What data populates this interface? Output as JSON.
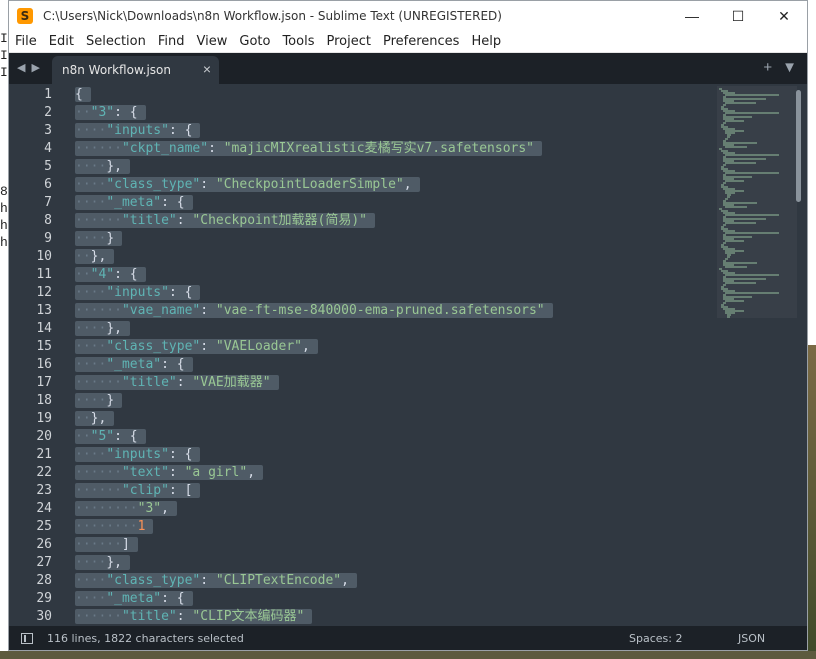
{
  "desktop_left_chars": [
    "I",
    "I",
    "I",
    "",
    "",
    "",
    "",
    "",
    "",
    "8",
    "h",
    "h",
    "h"
  ],
  "window": {
    "title": "C:\\Users\\Nick\\Downloads\\n8n Workflow.json - Sublime Text (UNREGISTERED)",
    "app_icon_letter": "S",
    "controls": {
      "minimize": "—",
      "maximize": "☐",
      "close": "✕"
    }
  },
  "menu": [
    "File",
    "Edit",
    "Selection",
    "Find",
    "View",
    "Goto",
    "Tools",
    "Project",
    "Preferences",
    "Help"
  ],
  "tabs": [
    {
      "label": "n8n Workflow.json",
      "close": "×"
    }
  ],
  "tabbar": {
    "nav_left": "◀",
    "nav_right": "▶",
    "new_tab": "+",
    "dropdown": "▼"
  },
  "editor": {
    "line_numbers": [
      "1",
      "2",
      "3",
      "4",
      "5",
      "6",
      "7",
      "8",
      "9",
      "10",
      "11",
      "12",
      "13",
      "14",
      "15",
      "16",
      "17",
      "18",
      "19",
      "20",
      "21",
      "22",
      "23",
      "24",
      "25",
      "26",
      "27",
      "28",
      "29",
      "30"
    ],
    "lines": [
      [
        {
          "t": "{",
          "c": "pun"
        }
      ],
      [
        {
          "t": "··",
          "c": "ind"
        },
        {
          "t": "\"3\"",
          "c": "key"
        },
        {
          "t": ": {",
          "c": "pun"
        }
      ],
      [
        {
          "t": "····",
          "c": "ind"
        },
        {
          "t": "\"inputs\"",
          "c": "key"
        },
        {
          "t": ": {",
          "c": "pun"
        }
      ],
      [
        {
          "t": "······",
          "c": "ind"
        },
        {
          "t": "\"ckpt_name\"",
          "c": "key"
        },
        {
          "t": ": ",
          "c": "pun"
        },
        {
          "t": "\"majicMIXrealistic麦橘写实v7.safetensors\"",
          "c": "str"
        }
      ],
      [
        {
          "t": "····",
          "c": "ind"
        },
        {
          "t": "},",
          "c": "pun"
        }
      ],
      [
        {
          "t": "····",
          "c": "ind"
        },
        {
          "t": "\"class_type\"",
          "c": "key"
        },
        {
          "t": ": ",
          "c": "pun"
        },
        {
          "t": "\"CheckpointLoaderSimple\"",
          "c": "str"
        },
        {
          "t": ",",
          "c": "pun"
        }
      ],
      [
        {
          "t": "····",
          "c": "ind"
        },
        {
          "t": "\"_meta\"",
          "c": "key"
        },
        {
          "t": ": {",
          "c": "pun"
        }
      ],
      [
        {
          "t": "······",
          "c": "ind"
        },
        {
          "t": "\"title\"",
          "c": "key"
        },
        {
          "t": ": ",
          "c": "pun"
        },
        {
          "t": "\"Checkpoint加载器(简易)\"",
          "c": "str"
        }
      ],
      [
        {
          "t": "····",
          "c": "ind"
        },
        {
          "t": "}",
          "c": "pun"
        }
      ],
      [
        {
          "t": "··",
          "c": "ind"
        },
        {
          "t": "},",
          "c": "pun"
        }
      ],
      [
        {
          "t": "··",
          "c": "ind"
        },
        {
          "t": "\"4\"",
          "c": "key"
        },
        {
          "t": ": {",
          "c": "pun"
        }
      ],
      [
        {
          "t": "····",
          "c": "ind"
        },
        {
          "t": "\"inputs\"",
          "c": "key"
        },
        {
          "t": ": {",
          "c": "pun"
        }
      ],
      [
        {
          "t": "······",
          "c": "ind"
        },
        {
          "t": "\"vae_name\"",
          "c": "key"
        },
        {
          "t": ": ",
          "c": "pun"
        },
        {
          "t": "\"vae-ft-mse-840000-ema-pruned.safetensors\"",
          "c": "str"
        }
      ],
      [
        {
          "t": "····",
          "c": "ind"
        },
        {
          "t": "},",
          "c": "pun"
        }
      ],
      [
        {
          "t": "····",
          "c": "ind"
        },
        {
          "t": "\"class_type\"",
          "c": "key"
        },
        {
          "t": ": ",
          "c": "pun"
        },
        {
          "t": "\"VAELoader\"",
          "c": "str"
        },
        {
          "t": ",",
          "c": "pun"
        }
      ],
      [
        {
          "t": "····",
          "c": "ind"
        },
        {
          "t": "\"_meta\"",
          "c": "key"
        },
        {
          "t": ": {",
          "c": "pun"
        }
      ],
      [
        {
          "t": "······",
          "c": "ind"
        },
        {
          "t": "\"title\"",
          "c": "key"
        },
        {
          "t": ": ",
          "c": "pun"
        },
        {
          "t": "\"VAE加载器\"",
          "c": "str"
        }
      ],
      [
        {
          "t": "····",
          "c": "ind"
        },
        {
          "t": "}",
          "c": "pun"
        }
      ],
      [
        {
          "t": "··",
          "c": "ind"
        },
        {
          "t": "},",
          "c": "pun"
        }
      ],
      [
        {
          "t": "··",
          "c": "ind"
        },
        {
          "t": "\"5\"",
          "c": "key"
        },
        {
          "t": ": {",
          "c": "pun"
        }
      ],
      [
        {
          "t": "····",
          "c": "ind"
        },
        {
          "t": "\"inputs\"",
          "c": "key"
        },
        {
          "t": ": {",
          "c": "pun"
        }
      ],
      [
        {
          "t": "······",
          "c": "ind"
        },
        {
          "t": "\"text\"",
          "c": "key"
        },
        {
          "t": ": ",
          "c": "pun"
        },
        {
          "t": "\"a girl\"",
          "c": "str"
        },
        {
          "t": ",",
          "c": "pun"
        }
      ],
      [
        {
          "t": "······",
          "c": "ind"
        },
        {
          "t": "\"clip\"",
          "c": "key"
        },
        {
          "t": ": [",
          "c": "pun"
        }
      ],
      [
        {
          "t": "········",
          "c": "ind"
        },
        {
          "t": "\"3\"",
          "c": "str"
        },
        {
          "t": ",",
          "c": "pun"
        }
      ],
      [
        {
          "t": "········",
          "c": "ind"
        },
        {
          "t": "1",
          "c": "num"
        }
      ],
      [
        {
          "t": "······",
          "c": "ind"
        },
        {
          "t": "]",
          "c": "pun"
        }
      ],
      [
        {
          "t": "····",
          "c": "ind"
        },
        {
          "t": "},",
          "c": "pun"
        }
      ],
      [
        {
          "t": "····",
          "c": "ind"
        },
        {
          "t": "\"class_type\"",
          "c": "key"
        },
        {
          "t": ": ",
          "c": "pun"
        },
        {
          "t": "\"CLIPTextEncode\"",
          "c": "str"
        },
        {
          "t": ",",
          "c": "pun"
        }
      ],
      [
        {
          "t": "····",
          "c": "ind"
        },
        {
          "t": "\"_meta\"",
          "c": "key"
        },
        {
          "t": ": {",
          "c": "pun"
        }
      ],
      [
        {
          "t": "······",
          "c": "ind"
        },
        {
          "t": "\"title\"",
          "c": "key"
        },
        {
          "t": ": ",
          "c": "pun"
        },
        {
          "t": "\"CLIP文本编码器\"",
          "c": "str"
        }
      ]
    ]
  },
  "status": {
    "selection": "116 lines, 1822 characters selected",
    "spaces": "Spaces: 2",
    "syntax": "JSON"
  },
  "colors": {
    "editor_bg": "#303841",
    "selection": "#4f5b66",
    "key": "#5fb4b4",
    "string": "#99c794",
    "number": "#f99157"
  }
}
